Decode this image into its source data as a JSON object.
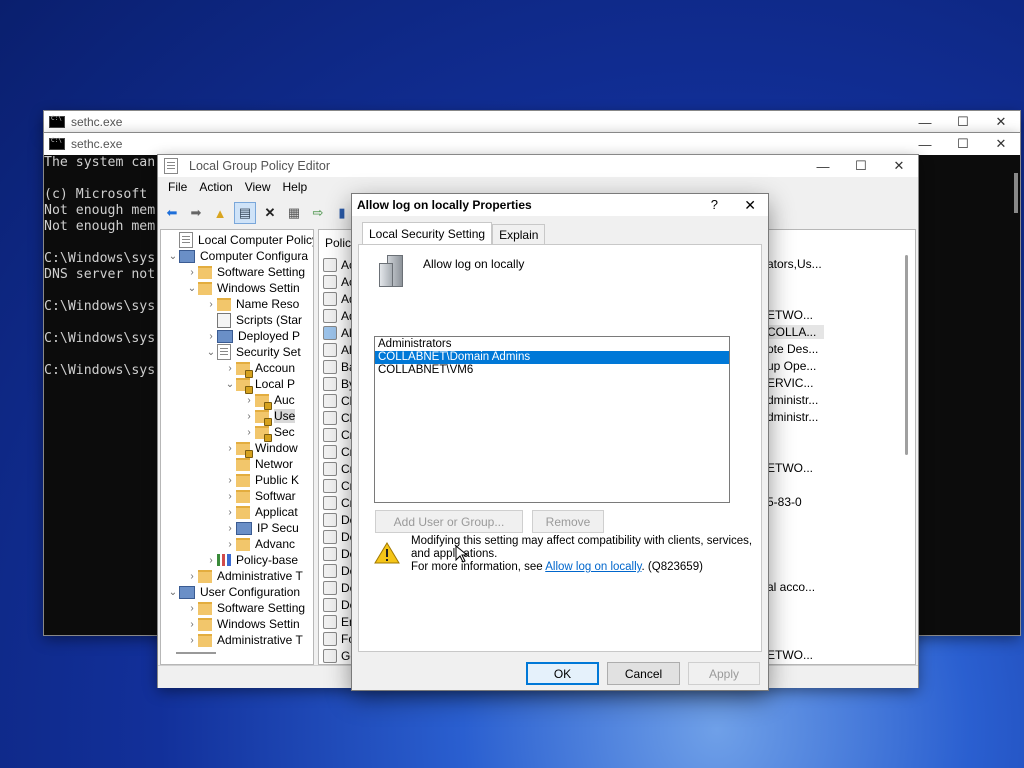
{
  "cmd_back": {
    "title": "sethc.exe",
    "controls": {
      "minimize": "—",
      "maximize": "☐",
      "close": "✕"
    }
  },
  "cmd_front": {
    "title": "sethc.exe",
    "lines": [
      "The system can",
      "",
      "(c) Microsoft",
      "Not enough mem",
      "Not enough mem",
      "",
      "C:\\Windows\\sys",
      "DNS server not",
      "",
      "C:\\Windows\\sys",
      "",
      "C:\\Windows\\sys",
      "",
      "C:\\Windows\\sys"
    ],
    "controls": {
      "minimize": "—",
      "maximize": "☐",
      "close": "✕"
    }
  },
  "gpedit": {
    "title": "Local Group Policy Editor",
    "menu": [
      "File",
      "Action",
      "View",
      "Help"
    ],
    "controls": {
      "minimize": "—",
      "maximize": "☐",
      "close": "✕"
    },
    "tree": [
      {
        "label": "Local Computer Policy",
        "icon": "policy-icon",
        "indent": 0,
        "chev": ""
      },
      {
        "label": "Computer Configura",
        "icon": "computer-icon",
        "indent": 0,
        "chev": "⌄"
      },
      {
        "label": "Software Setting",
        "icon": "folder-icon",
        "indent": 1,
        "chev": "›"
      },
      {
        "label": "Windows Settin",
        "icon": "folder-icon",
        "indent": 1,
        "chev": "⌄"
      },
      {
        "label": "Name Reso",
        "icon": "folder-icon",
        "indent": 2,
        "chev": "›"
      },
      {
        "label": "Scripts (Star",
        "icon": "script-icon",
        "indent": 2,
        "chev": ""
      },
      {
        "label": "Deployed P",
        "icon": "printer-icon",
        "indent": 2,
        "chev": "›"
      },
      {
        "label": "Security Set",
        "icon": "security-icon",
        "indent": 2,
        "chev": "⌄"
      },
      {
        "label": "Accoun",
        "icon": "folder-lock-icon",
        "indent": 3,
        "chev": "›"
      },
      {
        "label": "Local P",
        "icon": "folder-lock-icon",
        "indent": 3,
        "chev": "⌄"
      },
      {
        "label": "Auc",
        "icon": "folder-lock-icon",
        "indent": 4,
        "chev": "›"
      },
      {
        "label": "Use",
        "icon": "folder-lock-icon",
        "indent": 4,
        "chev": "›",
        "selected": true
      },
      {
        "label": "Sec",
        "icon": "folder-lock-icon",
        "indent": 4,
        "chev": "›"
      },
      {
        "label": "Window",
        "icon": "folder-lock-icon",
        "indent": 3,
        "chev": "›"
      },
      {
        "label": "Networ",
        "icon": "folder-icon",
        "indent": 3,
        "chev": ""
      },
      {
        "label": "Public K",
        "icon": "folder-icon",
        "indent": 3,
        "chev": "›"
      },
      {
        "label": "Softwar",
        "icon": "folder-icon",
        "indent": 3,
        "chev": "›"
      },
      {
        "label": "Applicat",
        "icon": "folder-icon",
        "indent": 3,
        "chev": "›"
      },
      {
        "label": "IP Secu",
        "icon": "ipsec-icon",
        "indent": 3,
        "chev": "›"
      },
      {
        "label": "Advanc",
        "icon": "folder-icon",
        "indent": 3,
        "chev": "›"
      },
      {
        "label": "Policy-base",
        "icon": "chart-icon",
        "indent": 2,
        "chev": "›"
      },
      {
        "label": "Administrative T",
        "icon": "folder-icon",
        "indent": 1,
        "chev": "›"
      },
      {
        "label": "User Configuration",
        "icon": "user-icon",
        "indent": 0,
        "chev": "⌄"
      },
      {
        "label": "Software Setting",
        "icon": "folder-icon",
        "indent": 1,
        "chev": "›"
      },
      {
        "label": "Windows Settin",
        "icon": "folder-icon",
        "indent": 1,
        "chev": "›"
      },
      {
        "label": "Administrative T",
        "icon": "folder-icon",
        "indent": 1,
        "chev": "›"
      }
    ],
    "list_header": "Policy",
    "list_rows": [
      "Ac",
      "Ac",
      "Ad",
      "Ad",
      "Allo",
      "Allo",
      "Ba",
      "By",
      "Ch",
      "Ch",
      "Cre",
      "Cre",
      "Cre",
      "Cre",
      "Cre",
      "De",
      "De",
      "De",
      "De",
      "De",
      "De",
      "En",
      "Fo",
      "Ge"
    ],
    "right_col": [
      {
        "row": 1,
        "text": "ators,Us..."
      },
      {
        "row": 4,
        "text": "ETWO..."
      },
      {
        "row": 5,
        "text": "COLLA..."
      },
      {
        "row": 6,
        "text": "ote Des..."
      },
      {
        "row": 7,
        "text": "up Ope..."
      },
      {
        "row": 8,
        "text": "ERVIC..."
      },
      {
        "row": 9,
        "text": "dministr..."
      },
      {
        "row": 10,
        "text": "dministr..."
      },
      {
        "row": 13,
        "text": "ETWO..."
      },
      {
        "row": 15,
        "text": "5-83-0"
      },
      {
        "row": 20,
        "text": "al acco..."
      },
      {
        "row": 24,
        "text": "ETWO..."
      }
    ]
  },
  "dialog": {
    "title": "Allow log on locally Properties",
    "help": "?",
    "close": "✕",
    "tabs": [
      "Local Security Setting",
      "Explain"
    ],
    "policy_name": "Allow log on locally",
    "members": [
      "Administrators",
      "COLLABNET\\Domain Admins",
      "COLLABNET\\VM6"
    ],
    "selected_index": 1,
    "add_button": "Add User or Group...",
    "remove_button": "Remove",
    "warning_line1": "Modifying this setting may affect compatibility with clients, services,",
    "warning_line2": "and applications.",
    "info_prefix": "For more information, see ",
    "info_link": "Allow log on locally",
    "info_suffix": ". (Q823659)",
    "ok": "OK",
    "cancel": "Cancel",
    "apply": "Apply"
  }
}
